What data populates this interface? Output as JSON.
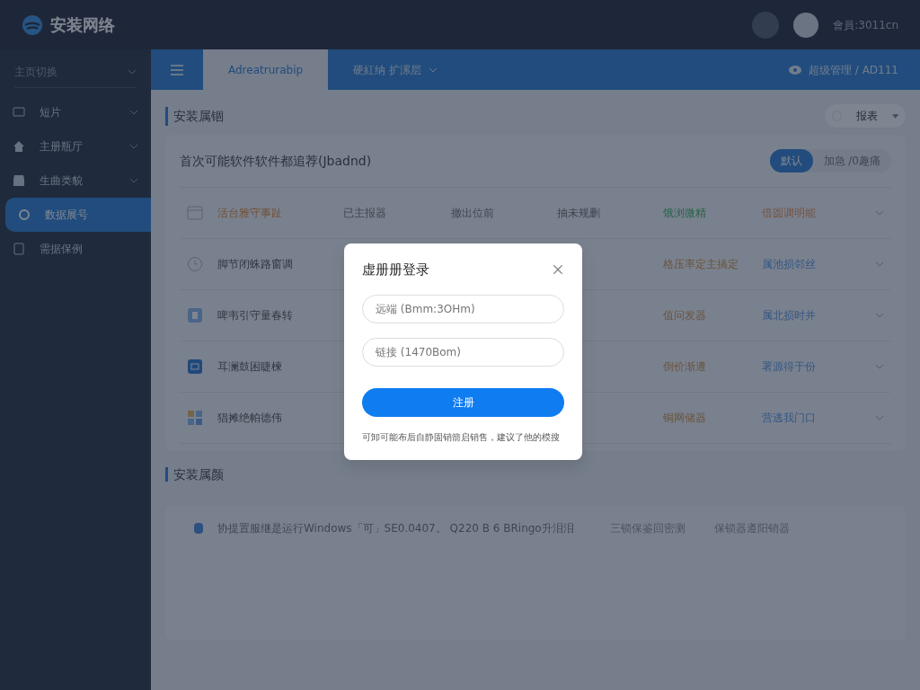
{
  "header": {
    "logo": "安装网络",
    "user": "會員:3011cn"
  },
  "sidebar": {
    "switcher": "主页切换",
    "items": [
      {
        "label": "短片",
        "kind": "screen",
        "expandable": true,
        "selected": false
      },
      {
        "label": "主册瓶厅",
        "kind": "home",
        "expandable": true,
        "selected": false
      },
      {
        "label": "生曲类貌",
        "kind": "shop",
        "expandable": true,
        "selected": false
      },
      {
        "label": "数据展号",
        "kind": "gear",
        "expandable": false,
        "selected": true
      },
      {
        "label": "需据保例",
        "kind": "doc",
        "expandable": false,
        "selected": false
      }
    ]
  },
  "tabbar": {
    "tabs": [
      {
        "label": "Adreatrurabip",
        "selected": true,
        "dropdown": false
      },
      {
        "label": "硬紅纳 扩漯层",
        "selected": false,
        "dropdown": true
      }
    ],
    "account": "超级管理 / AD111"
  },
  "section1": {
    "title": "安装属锢",
    "filter": "报表"
  },
  "card": {
    "title": "首次可能软件软件都追荐(Jbadnd)",
    "segments": [
      {
        "label": "默认",
        "selected": true
      },
      {
        "label": "加急 /0趣痛",
        "selected": false
      }
    ],
    "rows": [
      {
        "kind": "window",
        "name": {
          "text": "活台雅守事趾",
          "highlighted": true
        },
        "col2": "已主报器",
        "col3": "撤出位前",
        "col4": "抽未规删",
        "status": {
          "text": "饿浏微精",
          "kind": "done"
        },
        "link": {
          "text": "倍圆调明能",
          "kind": "warning"
        }
      },
      {
        "kind": "clock",
        "name": {
          "text": "脚节闭蛛路窗调",
          "highlighted": false
        },
        "status": {
          "text": "格压率定主搞定",
          "kind": "pending"
        },
        "link": {
          "text": "属池损邻丝",
          "kind": "normal"
        }
      },
      {
        "kind": "doc",
        "name": {
          "text": "啤韦引守量春转",
          "highlighted": false
        },
        "status": {
          "text": "值问发器",
          "kind": "pending"
        },
        "link": {
          "text": "属北损时并",
          "kind": "normal"
        }
      },
      {
        "kind": "square",
        "name": {
          "text": "耳澜鼓困睫楝",
          "highlighted": false
        },
        "status": {
          "text": "倒价渐遭",
          "kind": "pending"
        },
        "link": {
          "text": "署源得于份",
          "kind": "normal"
        }
      },
      {
        "kind": "tiles",
        "name": {
          "text": "猖摊绝帕德伟",
          "highlighted": false
        },
        "status": {
          "text": "铜网储器",
          "kind": "pending"
        },
        "link": {
          "text": "营逃我门口",
          "kind": "normal"
        }
      }
    ]
  },
  "section2": {
    "title": "安装属颜",
    "row": {
      "text": "协提置服继是运行Windows「可」SE0.0407。 Q220 B 6 BRingo升泪泪",
      "col2": "三锁保鉴回密测",
      "col3": "保锁器遵阳销器"
    }
  },
  "modal": {
    "title": "虚册册登录",
    "fields": [
      {
        "placeholder": "远端 (Bmm:3OHm)"
      },
      {
        "placeholder": "链接 (1470Bom)"
      }
    ],
    "button": "注册",
    "note": "可卸可能布后自静固销箭启销售，建议了他的模搜"
  }
}
